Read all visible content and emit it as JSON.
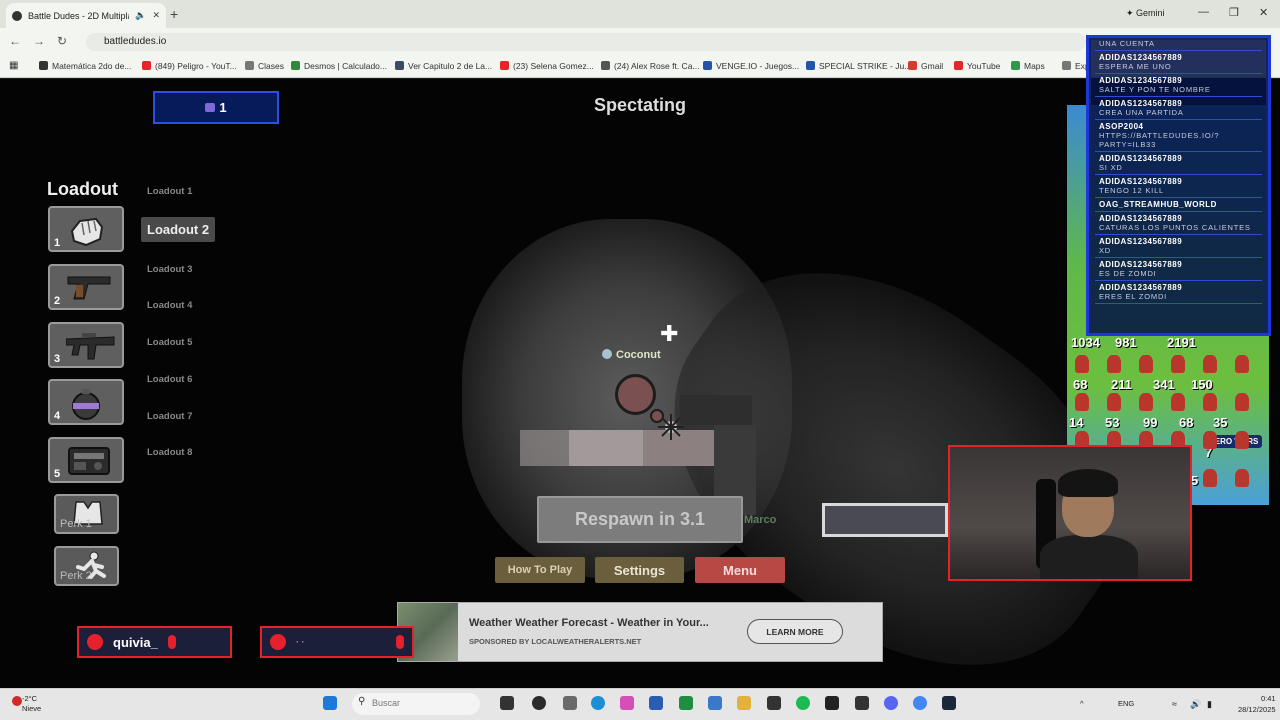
{
  "browser": {
    "tab_title": "Battle Dudes - 2D Multipla",
    "gemini_label": "Gemini",
    "url": "battledudes.io",
    "bookmarks": [
      {
        "label": "Matemática 2do de...",
        "color": "#333333"
      },
      {
        "label": "(849) Peligro - YouT...",
        "color": "#e02828"
      },
      {
        "label": "Clases",
        "color": "#777777"
      },
      {
        "label": "Desmos | Calculado...",
        "color": "#2f8b3a"
      },
      {
        "label": "Ver Capitulo 2 de La...",
        "color": "#3a4b6a"
      },
      {
        "label": "(23) Selena Gomez...",
        "color": "#e02828"
      },
      {
        "label": "(24) Alex Rose ft. Ca...",
        "color": "#555555"
      },
      {
        "label": "VENGE.IO - Juegos...",
        "color": "#2255aa"
      },
      {
        "label": "SPECIAL STRIKE - Ju...",
        "color": "#2255aa"
      },
      {
        "label": "Gmail",
        "color": "#d23f31"
      },
      {
        "label": "YouTube",
        "color": "#e02828"
      },
      {
        "label": "Maps",
        "color": "#2d9a4a"
      },
      {
        "label": "Exp",
        "color": "#777777"
      }
    ]
  },
  "game": {
    "party_count": "1",
    "status": "Spectating",
    "loadout_title": "Loadout",
    "slots": [
      {
        "num": "1",
        "icon": "fist-icon"
      },
      {
        "num": "2",
        "icon": "pistol-icon"
      },
      {
        "num": "3",
        "icon": "smg-icon"
      },
      {
        "num": "4",
        "icon": "grenade-icon"
      },
      {
        "num": "5",
        "icon": "gadget-icon"
      }
    ],
    "perks": [
      "Perk 1",
      "Perk 2"
    ],
    "loadouts": [
      "Loadout 1",
      "Loadout 2",
      "Loadout 3",
      "Loadout 4",
      "Loadout 5",
      "Loadout 6",
      "Loadout 7",
      "Loadout 8"
    ],
    "selected_loadout": "Loadout 2",
    "player_name": "Coconut",
    "other_player": "Marco",
    "respawn": "Respawn in 3.1",
    "buttons": {
      "how_to_play": "How To Play",
      "settings": "Settings",
      "menu": "Menu"
    }
  },
  "ad": {
    "headline": "Weather Weather Forecast - Weather in Your...",
    "sponsor": "SPONSORED BY LOCALWEATHERALERTS.NET",
    "cta": "LEARN MORE"
  },
  "stream": {
    "name_tag": "quivia_",
    "chat": [
      {
        "user": "",
        "text": "UNA CUENTA"
      },
      {
        "user": "ADIDAS1234567889",
        "text": "ESPERA ME UNO"
      },
      {
        "user": "ADIDAS1234567889",
        "text": "SALTE Y PON TE NOMBRE"
      },
      {
        "user": "ADIDAS1234567889",
        "text": "CREA UNA PARTIDA"
      },
      {
        "user": "ASOP2004",
        "text": "HTTPS://BATTLEDUDES.IO/?PARTY=ILB33"
      },
      {
        "user": "ADIDAS1234567889",
        "text": "SI XD"
      },
      {
        "user": "ADIDAS1234567889",
        "text": "TENGO 12 KILL"
      },
      {
        "user": "OAG_STREAMHUB_WORLD",
        "text": ""
      },
      {
        "user": "ADIDAS1234567889",
        "text": "CATURAS LOS PUNTOS CALIENTES"
      },
      {
        "user": "ADIDAS1234567889",
        "text": "XD"
      },
      {
        "user": "ADIDAS1234567889",
        "text": "ES DE ZOMDI"
      },
      {
        "user": "ADIDAS1234567889",
        "text": "ERES EL ZOMDI"
      }
    ],
    "war_numbers": [
      "1034",
      "981",
      "2191",
      "68",
      "211",
      "341",
      "150",
      "14",
      "53",
      "99",
      "68",
      "35",
      "7",
      "5"
    ],
    "war_logo": "HERO WARS"
  },
  "taskbar": {
    "temp": "-2°C",
    "weather": "Nieve",
    "search_placeholder": "Buscar",
    "lang": "ENG",
    "time": "0:41",
    "date": "28/12/2025"
  },
  "colors": {
    "accent_blue": "#1e37d7",
    "stream_red": "#e5212b",
    "menu_red": "#b84844",
    "button_gold": "#6a5e3c"
  }
}
